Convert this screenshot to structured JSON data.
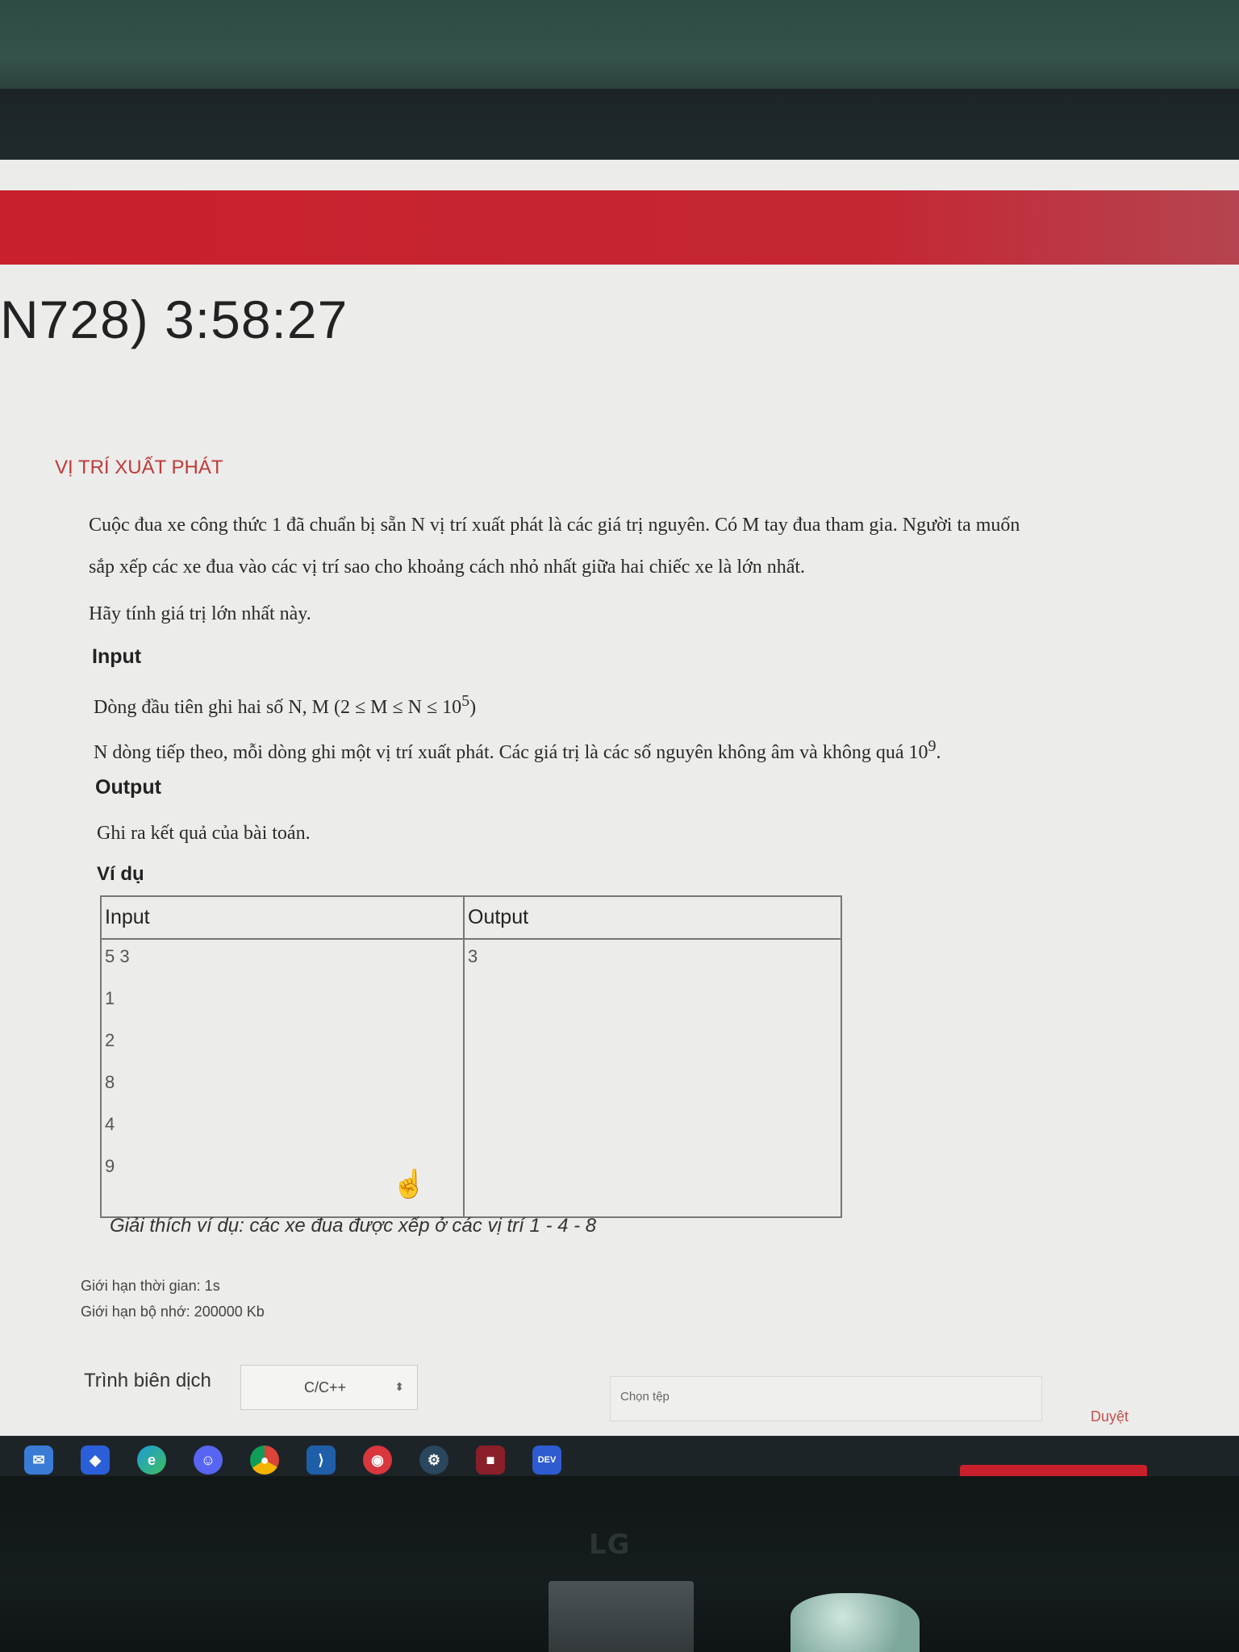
{
  "timer": "N728) 3:58:27",
  "problem": {
    "title": "VỊ TRÍ XUẤT PHÁT",
    "statement_1": "Cuộc đua xe công thức 1 đã chuẩn bị sẵn N vị trí xuất phát là các giá trị nguyên. Có M tay đua tham gia. Người ta muốn",
    "statement_2": "sắp xếp các xe đua vào các vị trí sao cho khoảng cách nhỏ nhất giữa hai chiếc xe là lớn nhất.",
    "statement_3": "Hãy tính giá trị lớn nhất này.",
    "input_heading": "Input",
    "input_1_prefix": "Dòng đầu tiên ghi hai số N, M (2 ≤ M ≤ N ≤ 10",
    "input_1_exp": "5",
    "input_1_suffix": ")",
    "input_2_prefix": "N dòng tiếp theo, mỗi dòng ghi một vị trí xuất phát. Các giá trị là các số nguyên không âm và không quá 10",
    "input_2_exp": "9",
    "input_2_suffix": ".",
    "output_heading": "Output",
    "output_text": "Ghi ra kết quả của bài toán.",
    "example_heading": "Ví dụ",
    "example": {
      "col_input": "Input",
      "col_output": "Output",
      "input_lines": [
        "5  3",
        "1",
        "2",
        "8",
        "4",
        "9"
      ],
      "output_lines": [
        "3"
      ]
    },
    "explanation": "Giải thích ví dụ: các xe đua được xếp ở các vị trí 1 - 4 - 8"
  },
  "limits": {
    "time": "Giới hạn thời gian: 1s",
    "memory": "Giới hạn bộ nhớ: 200000 Kb"
  },
  "submit": {
    "compiler_label": "Trình biên dịch",
    "compiler_value": "C/C++",
    "file_placeholder": "Chọn tệp",
    "browse_label": "Duyệt"
  },
  "taskbar": {
    "icons": [
      "mail-icon",
      "dropbox-icon",
      "edge-icon",
      "discord-icon",
      "chrome-icon",
      "vscode-icon",
      "app-icon",
      "steam-icon",
      "app-red-icon",
      "dev-icon"
    ],
    "dev_label": "DEV"
  },
  "monitor_brand": "LG"
}
